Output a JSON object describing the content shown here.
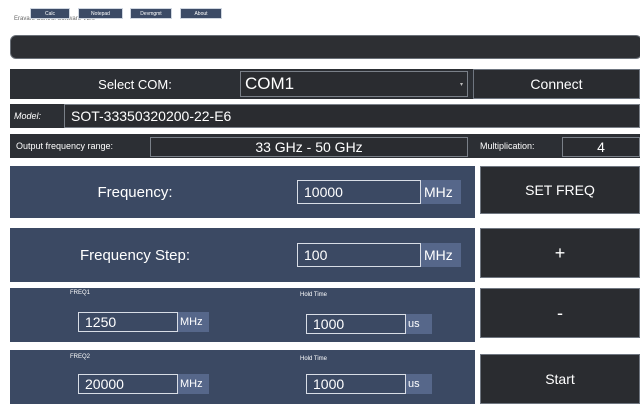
{
  "window": {
    "title": "Eravant Control Software V2.0"
  },
  "toolbar": {
    "calc": "Calc",
    "notepad": "Notepad",
    "devmgmt": "Devmgmt",
    "about": "About"
  },
  "com": {
    "label": "Select COM:",
    "value": "COM1",
    "connect": "Connect"
  },
  "model": {
    "label": "Model:",
    "value": "SOT-33350320200-22-E6"
  },
  "output": {
    "label": "Output frequency range:",
    "value": "33 GHz - 50 GHz",
    "mult_label": "Multiplication:",
    "mult_value": "4"
  },
  "frequency": {
    "label": "Frequency:",
    "value": "10000",
    "unit": "MHz",
    "button": "SET FREQ"
  },
  "step": {
    "label": "Frequency Step:",
    "value": "100",
    "unit": "MHz",
    "button": "+"
  },
  "freq1": {
    "label": "FREQ1",
    "value": "1250",
    "unit": "MHz",
    "hold_label": "Hold Time",
    "hold_value": "1000",
    "hold_unit": "us",
    "button": "-"
  },
  "freq2": {
    "label": "FREQ2",
    "value": "20000",
    "unit": "MHz",
    "hold_label": "Hold Time",
    "hold_value": "1000",
    "hold_unit": "us",
    "button": "Start"
  }
}
